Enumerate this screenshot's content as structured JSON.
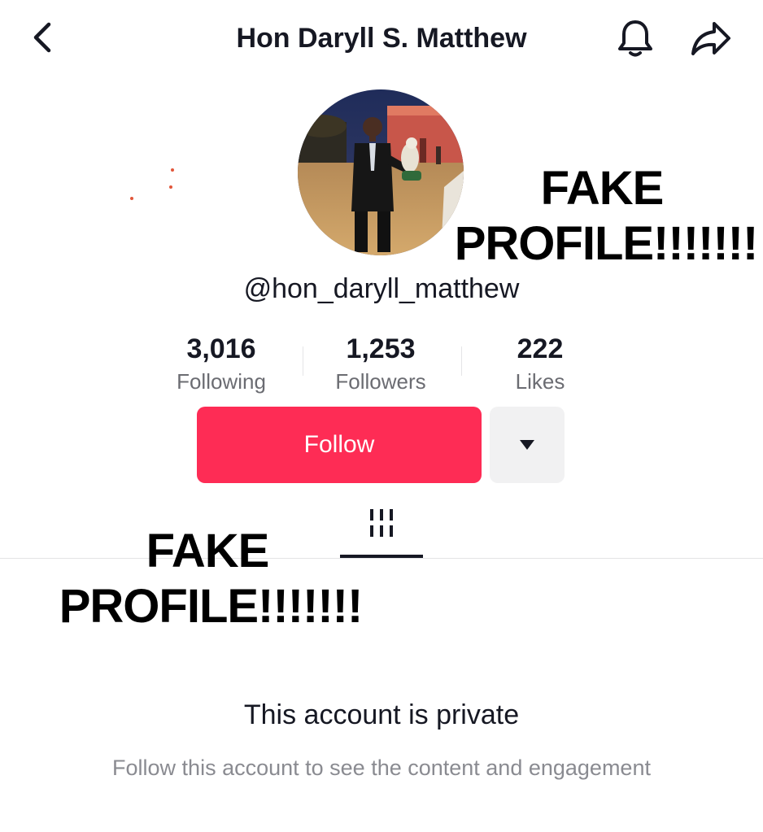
{
  "header": {
    "title": "Hon Daryll S. Matthew",
    "back_icon": "chevron-left-icon",
    "notification_icon": "bell-icon",
    "share_icon": "share-arrow-icon"
  },
  "profile": {
    "username": "@hon_daryll_matthew",
    "avatar": "profile-photo"
  },
  "stats": {
    "following": {
      "value": "3,016",
      "label": "Following"
    },
    "followers": {
      "value": "1,253",
      "label": "Followers"
    },
    "likes": {
      "value": "222",
      "label": "Likes"
    }
  },
  "actions": {
    "follow_label": "Follow",
    "more_icon": "caret-down-icon",
    "accent_color": "#fe2c55"
  },
  "tabs": {
    "active_icon": "grid-icon"
  },
  "overlay": {
    "line1": "FAKE",
    "line2": "PROFILE!!!!!!!"
  },
  "private_notice": {
    "title": "This account is private",
    "description": "Follow this account to see the content and engagement"
  }
}
